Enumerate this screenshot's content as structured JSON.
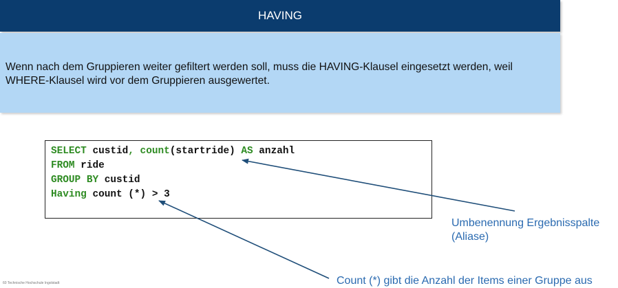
{
  "title": "HAVING",
  "description": "Wenn nach dem Gruppieren weiter gefiltert werden soll, muss die HAVING-Klausel eingesetzt werden, weil WHERE-Klausel wird vor dem Gruppieren ausgewertet.",
  "code": {
    "line1": {
      "kw1": "SELECT",
      "t1": " custid",
      "kw2": ", count",
      "t2": "(startride) ",
      "kw3": "AS",
      "t3": " anzahl"
    },
    "line2": {
      "kw1": "FROM",
      "t1": " ride"
    },
    "line3": {
      "kw1": "GROUP BY",
      "t1": " custid"
    },
    "line4": {
      "kw1": "Having",
      "t1": " count (*) > 3"
    }
  },
  "annotations": {
    "alias_line1": "Umbenennung Ergebnisspalte",
    "alias_line2": "(Aliase)",
    "count": "Count (*) gibt die Anzahl der Items einer Gruppe aus"
  },
  "footer": "60    Technische Hochschule Ingolstadt",
  "colors": {
    "title_bg": "#0b3c6e",
    "info_bg": "#b3d7f5",
    "keyword": "#2e8b22",
    "annotation": "#2a6ab0"
  }
}
